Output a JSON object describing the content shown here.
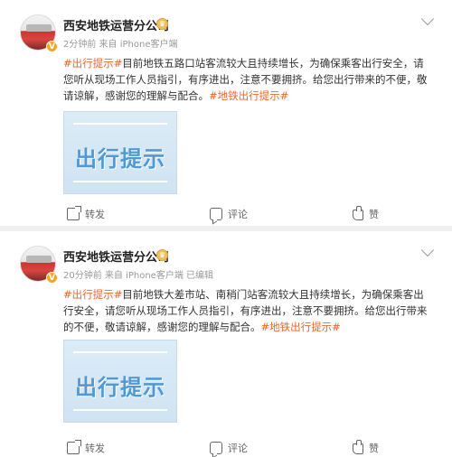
{
  "posts": [
    {
      "author": "西安地铁运营分公司",
      "meta": "2分钟前  来自 iPhone客户端",
      "tag_start": "#出行提示#",
      "body": "目前地铁五路口站客流较大且持续增长，为确保乘客出行安全，请您听从现场工作人员指引，有序进出，注意不要拥挤。给您出行带来的不便，敬请谅解，感谢您的理解与配合。",
      "tag_end": "#地铁出行提示#",
      "image_text": "出行提示",
      "actions": {
        "share": "转发",
        "comment": "评论",
        "like": "赞"
      }
    },
    {
      "author": "西安地铁运营分公司",
      "meta": "20分钟前  来自 iPhone客户端 已编辑",
      "tag_start": "#出行提示#",
      "body": "目前地铁大差市站、南稍门站客流较大且持续增长，为确保乘客出行安全，请您听从现场工作人员指引，有序进出，注意不要拥挤。给您出行带来的不便，敬请谅解，感谢您的理解与配合。",
      "tag_end": "#地铁出行提示#",
      "image_text": "出行提示",
      "actions": {
        "share": "转发",
        "comment": "评论",
        "like": "赞"
      }
    }
  ],
  "icons": [
    "verified-v-icon",
    "crown-badge-icon",
    "chevron-down-icon",
    "share-icon",
    "comment-icon",
    "like-icon"
  ],
  "colors": {
    "tag": "#e8692a",
    "meta": "#999999",
    "image_text": "#4f9ad6"
  }
}
